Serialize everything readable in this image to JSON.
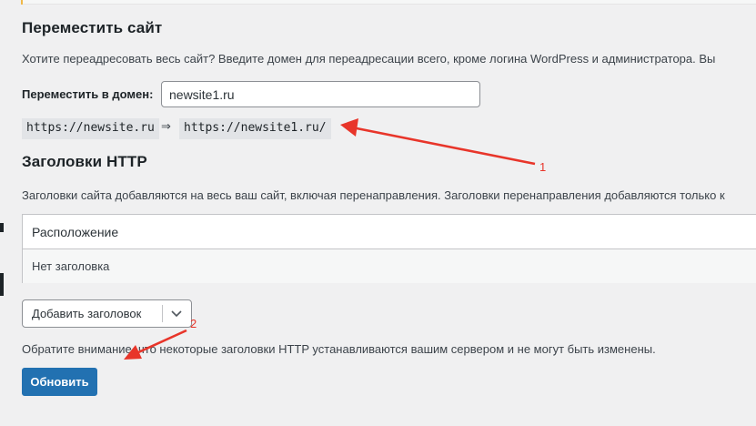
{
  "move_site": {
    "title": "Переместить сайт",
    "description": "Хотите переадресовать весь сайт? Введите домен для переадресации всего, кроме логина WordPress и администратора. Вы",
    "domain_label": "Переместить в домен:",
    "domain_value": "newsite1.ru",
    "from_url": "https://newsite.ru",
    "arrow": "⇒",
    "to_url": "https://newsite1.ru/"
  },
  "http_headers": {
    "title": "Заголовки HTTP",
    "description": "Заголовки сайта добавляются на весь ваш сайт, включая перенаправления. Заголовки перенаправления добавляются только к",
    "table": {
      "column_header": "Расположение",
      "empty_row": "Нет заголовка"
    },
    "add_select_value": "Добавить заголовок",
    "note": "Обратите внимание, что некоторые заголовки HTTP устанавливаются вашим сервером и не могут быть изменены."
  },
  "update_button": "Обновить",
  "annotations": {
    "label_1": "1",
    "label_2": "2",
    "color": "#e8352a"
  },
  "colors": {
    "primary": "#2271b1",
    "background": "#f0f0f1"
  }
}
